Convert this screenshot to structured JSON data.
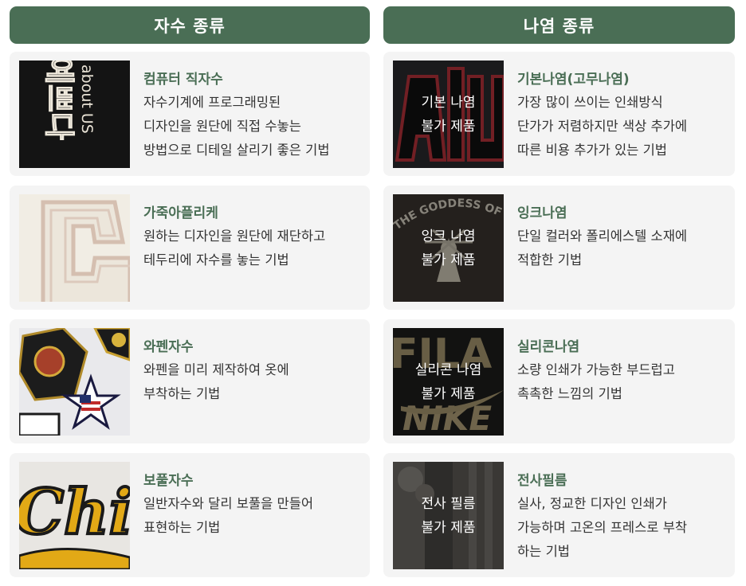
{
  "left": {
    "header": "자수 종류",
    "cards": [
      {
        "title": "컴퓨터 직자수",
        "lines": [
          "자수기계에 프로그래밍된",
          "디자인을 원단에 직접 수놓는",
          "방법으로 디테일 살리기 좋은 기법"
        ],
        "image": "embroidery-text-image"
      },
      {
        "title": "가죽아플리케",
        "lines": [
          "원하는 디자인을 원단에 재단하고",
          "테두리에 자수를 놓는 기법"
        ],
        "image": "leather-applique-image"
      },
      {
        "title": "와펜자수",
        "lines": [
          "와펜을 미리 제작하여 옷에",
          "부착하는 기법"
        ],
        "image": "patch-embroidery-image"
      },
      {
        "title": "보풀자수",
        "lines": [
          "일반자수와 달리 보풀을 만들어",
          "표현하는 기법"
        ],
        "image": "chenille-embroidery-image"
      }
    ]
  },
  "right": {
    "header": "나염 종류",
    "cards": [
      {
        "title": "기본나염(고무나염)",
        "lines": [
          "가장 많이 쓰이는 인쇄방식",
          "단가가 저렴하지만 색상 추가에",
          "따른 비용 추가가 있는 기법"
        ],
        "overlay": [
          "기본 나염",
          "불가 제품"
        ],
        "image": "rubber-print-image"
      },
      {
        "title": "잉크나염",
        "lines": [
          "단일 컬러와 폴리에스텔 소재에",
          "적합한 기법"
        ],
        "overlay": [
          "잉크 나염",
          "불가 제품"
        ],
        "image": "ink-print-image",
        "image_text": "THE GODDESS OF VICTORY"
      },
      {
        "title": "실리콘나염",
        "lines": [
          "소량 인쇄가 가능한 부드럽고",
          "촉촉한 느낌의 기법"
        ],
        "overlay": [
          "실리콘 나염",
          "불가 제품"
        ],
        "image": "silicone-print-image",
        "image_text": [
          "FILA",
          "NIKE"
        ]
      },
      {
        "title": "전사필름",
        "lines": [
          "실사, 정교한 디자인 인쇄가",
          "가능하며 고온의 프레스로 부착",
          "하는 기법"
        ],
        "overlay": [
          "전사 필름",
          "불가 제품"
        ],
        "image": "transfer-film-image"
      }
    ]
  },
  "image_texts": {
    "embroidery": [
      "about US",
      "예쁘다"
    ],
    "chenille": "Chi"
  },
  "colors": {
    "header_bg": "#4a6e55",
    "title": "#4a6e55",
    "card_bg": "#f4f4f4"
  }
}
